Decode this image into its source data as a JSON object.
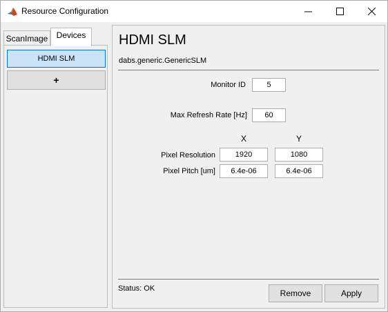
{
  "window": {
    "title": "Resource Configuration"
  },
  "sidebar": {
    "tabs": [
      {
        "label": "ScanImage"
      },
      {
        "label": "Devices"
      }
    ],
    "devices": [
      {
        "label": "HDMI SLM"
      }
    ],
    "add_label": "+"
  },
  "device": {
    "name": "HDMI SLM",
    "class": "dabs.generic.GenericSLM",
    "monitor_id": {
      "label": "Monitor ID",
      "value": "5"
    },
    "max_refresh": {
      "label": "Max Refresh Rate [Hz]",
      "value": "60"
    },
    "columns": {
      "x": "X",
      "y": "Y"
    },
    "pixel_resolution": {
      "label": "Pixel Resolution",
      "x": "1920",
      "y": "1080"
    },
    "pixel_pitch": {
      "label": "Pixel Pitch [um]",
      "x": "6.4e-06",
      "y": "6.4e-06"
    }
  },
  "footer": {
    "status": "Status: OK",
    "remove_label": "Remove",
    "apply_label": "Apply"
  },
  "colors": {
    "accent": "#0078d7",
    "selected_bg": "#cce4f7"
  }
}
